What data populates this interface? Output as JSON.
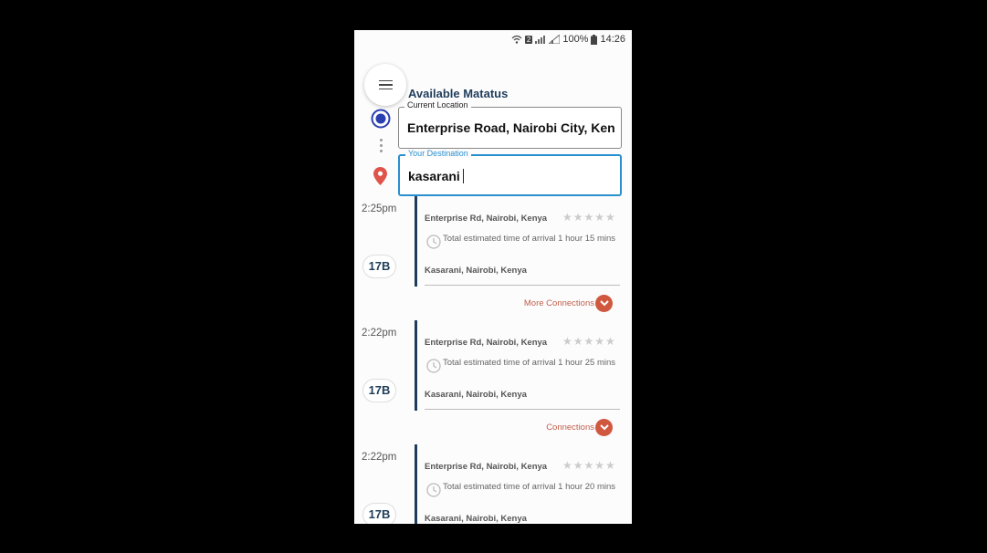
{
  "status_bar": {
    "battery": "100%",
    "time": "14:26",
    "sim_label": "2"
  },
  "header": {
    "title": "Available Matatus"
  },
  "current_location": {
    "label": "Current Location",
    "value": "Enterprise Road, Nairobi City, Ken"
  },
  "destination": {
    "label": "Your Destination",
    "value": "kasarani"
  },
  "icons": {
    "menu": "hamburger-menu-icon",
    "current": "current-location-icon",
    "pin": "map-pin-icon",
    "clock": "clock-icon",
    "expand": "chevron-down-icon"
  },
  "colors": {
    "accent": "#1f3d5a",
    "focus": "#2a8fcf",
    "connection": "#d0583f",
    "pin": "#e0534a"
  },
  "results": [
    {
      "time": "2:25pm",
      "route": "17B",
      "from": "Enterprise Rd, Nairobi, Kenya",
      "rating": "★★★★★",
      "eta": "Total estimated time of arrival 1 hour 15 mins",
      "to": "Kasarani, Nairobi, Kenya",
      "connections": "More Connections"
    },
    {
      "time": "2:22pm",
      "route": "17B",
      "from": "Enterprise Rd, Nairobi, Kenya",
      "rating": "★★★★★",
      "eta": "Total estimated time of arrival 1 hour 25 mins",
      "to": "Kasarani, Nairobi, Kenya",
      "connections": "Connections"
    },
    {
      "time": "2:22pm",
      "route": "17B",
      "from": "Enterprise Rd, Nairobi, Kenya",
      "rating": "★★★★★",
      "eta": "Total estimated time of arrival 1 hour 20 mins",
      "to": "Kasarani, Nairobi, Kenya",
      "connections": ""
    }
  ]
}
